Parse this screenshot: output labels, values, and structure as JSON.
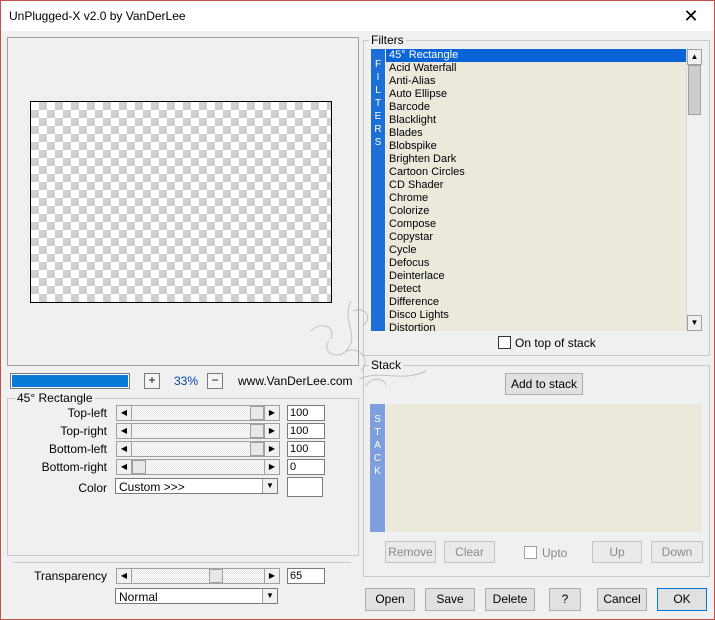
{
  "window": {
    "title": "UnPlugged-X v2.0 by VanDerLee",
    "close_glyph": "✕"
  },
  "preview": {
    "zoom_minus": "+",
    "zoom_value": "33%",
    "zoom_plus": "−",
    "url": "www.VanDerLee.com",
    "progress_fraction": 1.0
  },
  "params": {
    "group_title": "45° Rectangle",
    "top_left": {
      "label": "Top-left",
      "value": "100",
      "level": 1.0
    },
    "top_right": {
      "label": "Top-right",
      "value": "100",
      "level": 1.0
    },
    "bottom_left": {
      "label": "Bottom-left",
      "value": "100",
      "level": 1.0
    },
    "bottom_right": {
      "label": "Bottom-right",
      "value": "0",
      "level": 0.0
    },
    "color": {
      "label": "Color",
      "selected": "Custom >>>"
    }
  },
  "transparency": {
    "label": "Transparency",
    "value": "65",
    "level": 0.65,
    "blend_mode": "Normal"
  },
  "filters": {
    "group_title": "Filters",
    "strip_letters": [
      "F",
      "I",
      "L",
      "T",
      "E",
      "R",
      "S"
    ],
    "items": [
      "45° Rectangle",
      "Acid Waterfall",
      "Anti-Alias",
      "Auto Ellipse",
      "Barcode",
      "Blacklight",
      "Blades",
      "Blobspike",
      "Brighten Dark",
      "Cartoon Circles",
      "CD Shader",
      "Chrome",
      "Colorize",
      "Compose",
      "Copystar",
      "Cycle",
      "Defocus",
      "Deinterlace",
      "Detect",
      "Difference",
      "Disco Lights",
      "Distortion"
    ],
    "selected_index": 0,
    "on_top_label": "On top of stack"
  },
  "stack": {
    "group_title": "Stack",
    "add_label": "Add to stack",
    "strip_letters": [
      "S",
      "T",
      "A",
      "C",
      "K"
    ],
    "remove_label": "Remove",
    "clear_label": "Clear",
    "upto_label": "Upto",
    "up_label": "Up",
    "down_label": "Down"
  },
  "footer": {
    "open_label": "Open",
    "save_label": "Save",
    "delete_label": "Delete",
    "help_label": "?",
    "cancel_label": "Cancel",
    "ok_label": "OK"
  },
  "colors": {
    "selection": "#0a64d8",
    "filter_strip": "#1c6fd6",
    "stack_strip": "#7f9edc",
    "list_bg": "#ebe8dc",
    "window_border": "#c0504d"
  }
}
